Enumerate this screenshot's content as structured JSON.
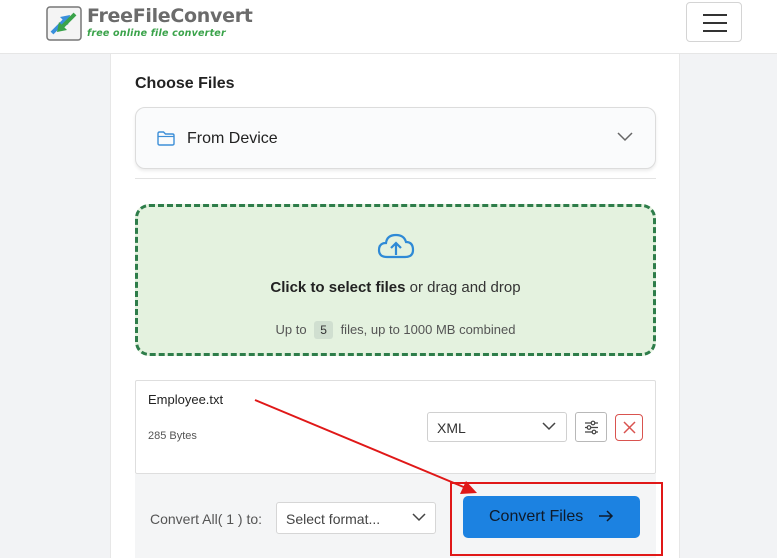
{
  "header": {
    "logo_title": "FreeFileConvert",
    "logo_subtitle": "free online file converter",
    "menu_icon": "hamburger-menu-icon"
  },
  "choose": {
    "title": "Choose Files",
    "source_label": "From Device",
    "source_icon": "folder-icon"
  },
  "dropzone": {
    "bold_text": "Click to select files",
    "rest_text": "or drag and drop",
    "limit_prefix": "Up to",
    "limit_count": "5",
    "limit_suffix": "files, up to 1000 MB combined",
    "icon": "cloud-upload-icon"
  },
  "file": {
    "name": "Employee.txt",
    "size": "285 Bytes",
    "target_format": "XML"
  },
  "bottom": {
    "convert_all_label": "Convert All( 1 ) to:",
    "format_placeholder": "Select format...",
    "convert_button": "Convert Files"
  },
  "colors": {
    "accent": "#1c82e1",
    "dropzone_border": "#2e7d4a",
    "dropzone_bg": "#e4f2df",
    "annotation": "#e01818",
    "logo_green": "#3aa34a"
  }
}
